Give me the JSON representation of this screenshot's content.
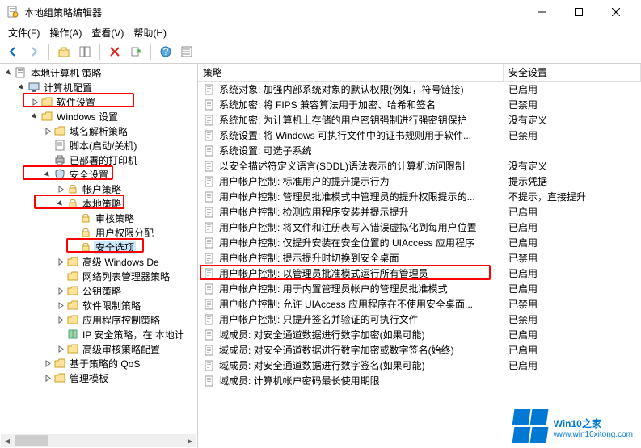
{
  "window": {
    "title": "本地组策略编辑器"
  },
  "menu": {
    "file": "文件(F)",
    "action": "操作(A)",
    "view": "查看(V)",
    "help": "帮助(H)"
  },
  "columns": {
    "policy": "策略",
    "setting": "安全设置"
  },
  "tree": {
    "root": "本地计算机 策略",
    "computer_config": "计算机配置",
    "software_settings": "软件设置",
    "windows_settings": "Windows 设置",
    "name_resolution": "域名解析策略",
    "scripts": "脚本(启动/关机)",
    "deployed_printers": "已部署的打印机",
    "security_settings": "安全设置",
    "account_policies": "帐户策略",
    "local_policies": "本地策略",
    "audit_policy": "审核策略",
    "user_rights": "用户权限分配",
    "security_options": "安全选项",
    "advanced_windows_de": "高级 Windows De",
    "network_list_mgr": "网络列表管理器策略",
    "public_key": "公钥策略",
    "software_restriction": "软件限制策略",
    "app_control": "应用程序控制策略",
    "ip_security": "IP 安全策略，在 本地计",
    "advanced_audit": "高级审核策略配置",
    "policy_qos": "基于策略的 QoS",
    "admin_templates": "管理模板"
  },
  "policies": [
    {
      "name": "系统对象: 加强内部系统对象的默认权限(例如，符号链接)",
      "setting": "已启用"
    },
    {
      "name": "系统加密: 将 FIPS 兼容算法用于加密、哈希和签名",
      "setting": "已禁用"
    },
    {
      "name": "系统加密: 为计算机上存储的用户密钥强制进行强密钥保护",
      "setting": "没有定义"
    },
    {
      "name": "系统设置: 将 Windows 可执行文件中的证书规则用于软件...",
      "setting": "已禁用"
    },
    {
      "name": "系统设置: 可选子系统",
      "setting": ""
    },
    {
      "name": "以安全描述符定义语言(SDDL)语法表示的计算机访问限制",
      "setting": "没有定义"
    },
    {
      "name": "用户帐户控制: 标准用户的提升提示行为",
      "setting": "提示凭据"
    },
    {
      "name": "用户帐户控制: 管理员批准模式中管理员的提升权限提示的...",
      "setting": "不提示，直接提升"
    },
    {
      "name": "用户帐户控制: 检测应用程序安装并提示提升",
      "setting": "已启用"
    },
    {
      "name": "用户帐户控制: 将文件和注册表写入错误虚拟化到每用户位置",
      "setting": "已启用"
    },
    {
      "name": "用户帐户控制: 仅提升安装在安全位置的 UIAccess 应用程序",
      "setting": "已启用"
    },
    {
      "name": "用户帐户控制: 提示提升时切换到安全桌面",
      "setting": "已禁用"
    },
    {
      "name": "用户帐户控制: 以管理员批准模式运行所有管理员",
      "setting": "已启用"
    },
    {
      "name": "用户帐户控制: 用于内置管理员帐户的管理员批准模式",
      "setting": "已启用"
    },
    {
      "name": "用户帐户控制: 允许 UIAccess 应用程序在不使用安全桌面...",
      "setting": "已禁用"
    },
    {
      "name": "用户帐户控制: 只提升签名并验证的可执行文件",
      "setting": "已禁用"
    },
    {
      "name": "域成员: 对安全通道数据进行数字加密(如果可能)",
      "setting": "已启用"
    },
    {
      "name": "域成员: 对安全通道数据进行数字加密或数字签名(始终)",
      "setting": "已启用"
    },
    {
      "name": "域成员: 对安全通道数据进行数字签名(如果可能)",
      "setting": "已启用"
    },
    {
      "name": "域成员: 计算机帐户密码最长使用期限",
      "setting": ""
    }
  ],
  "watermark": {
    "brand": "Win10",
    "suffix": "之家",
    "url": "www.win10xitong.com"
  }
}
